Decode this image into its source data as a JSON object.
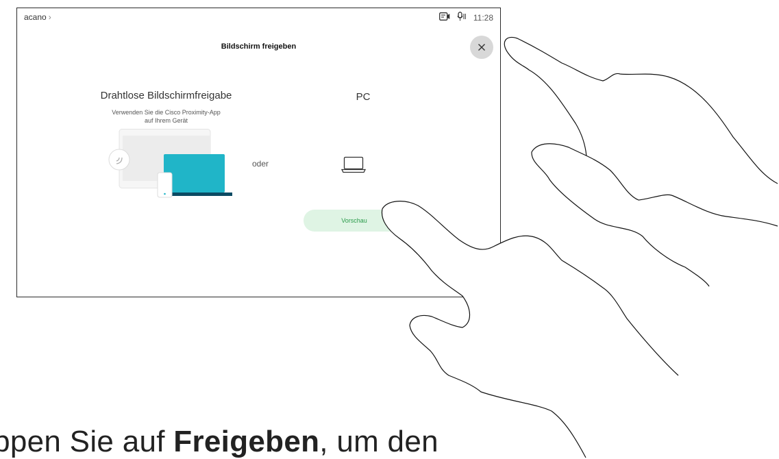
{
  "topbar": {
    "breadcrumb": "acano",
    "breadcrumb_chevron": "›",
    "time": "11:28",
    "icons": [
      "camera-icon",
      "mic-icon"
    ]
  },
  "dialog": {
    "title": "Bildschirm freigeben",
    "close_icon": "close-icon",
    "wireless": {
      "title": "Drahtlose Bildschirmfreigabe",
      "subtitle_line1": "Verwenden Sie die Cisco Proximity-App",
      "subtitle_line2": "auf Ihrem Gerät"
    },
    "separator": "oder",
    "pc": {
      "title": "PC",
      "icon": "laptop-icon"
    },
    "preview_button": "Vorschau"
  },
  "instruction": {
    "prefix": "ippen Sie auf ",
    "emphasis": "Freigeben",
    "suffix": ", um den"
  },
  "colors": {
    "accent_teal": "#20b5c8",
    "laptop_base": "#0b4a63",
    "preview_bg": "#dff4e4",
    "preview_text": "#2a9a4a",
    "close_bg": "#d8d8d8"
  }
}
